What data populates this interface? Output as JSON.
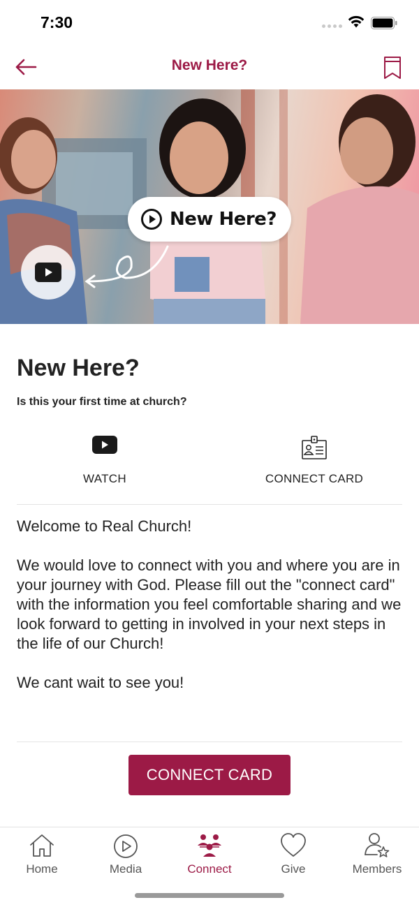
{
  "status_bar": {
    "time": "7:30"
  },
  "nav": {
    "title": "New Here?",
    "back_icon": "arrow-left-icon",
    "bookmark_icon": "bookmark-icon"
  },
  "hero": {
    "pill_text": "New Here?",
    "pill_icon": "play-circle-icon",
    "play_icon": "youtube-play-icon"
  },
  "content": {
    "heading": "New Here?",
    "subheading": "Is this your first time at church?",
    "actions": [
      {
        "label": "WATCH",
        "icon": "youtube-play-icon"
      },
      {
        "label": "CONNECT CARD",
        "icon": "id-card-icon"
      }
    ],
    "paragraphs": [
      "Welcome to Real Church!",
      "We would love to connect with you and where you are in your journey with God. Please fill out the \"connect card\" with the information you feel comfortable sharing and we look forward to getting in involved in your next steps in the life of our Church!",
      "We cant wait to see you!"
    ],
    "cta_label": "CONNECT CARD"
  },
  "tabs": [
    {
      "label": "Home",
      "icon": "home-icon",
      "active": false
    },
    {
      "label": "Media",
      "icon": "play-circle-icon",
      "active": false
    },
    {
      "label": "Connect",
      "icon": "people-icon",
      "active": true
    },
    {
      "label": "Give",
      "icon": "heart-icon",
      "active": false
    },
    {
      "label": "Members",
      "icon": "member-star-icon",
      "active": false
    }
  ],
  "colors": {
    "accent": "#9c1a46",
    "text": "#222222",
    "tab_inactive": "#555555"
  }
}
